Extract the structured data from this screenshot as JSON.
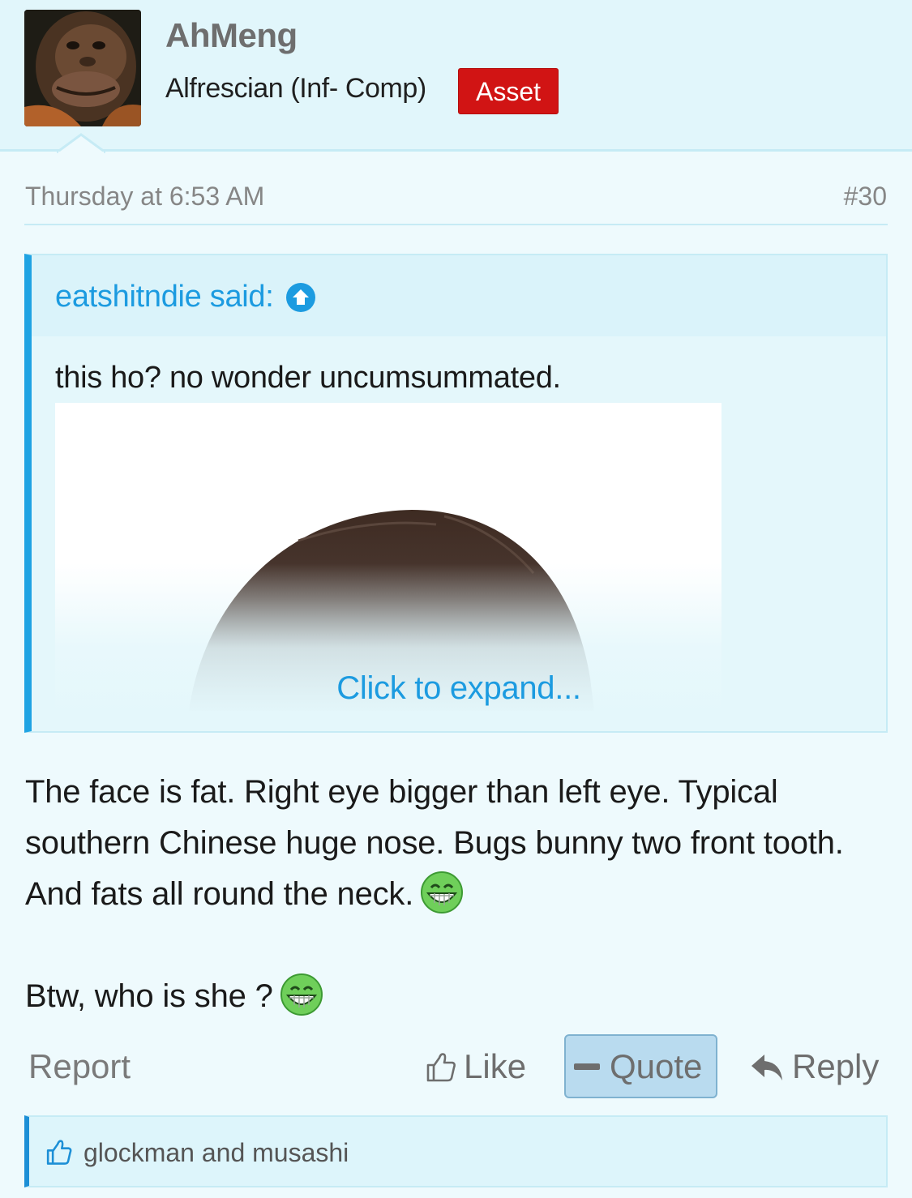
{
  "user": {
    "name": "AhMeng",
    "title": "Alfrescian (Inf- Comp)",
    "badge": "Asset"
  },
  "post": {
    "date": "Thursday at 6:53 AM",
    "number": "#30",
    "quote": {
      "author": "eatshitndie said:",
      "text": "this ho? no wonder uncumsummated.",
      "expand_label": "Click to expand..."
    },
    "body": [
      "The face is fat. Right eye bigger than left eye. Typical southern Chinese huge nose. Bugs bunny two front tooth. And fats all round the neck.",
      "Btw, who is she ?"
    ]
  },
  "actions": {
    "report": "Report",
    "like": "Like",
    "quote": "Quote",
    "reply": "Reply"
  },
  "likes": {
    "text": "glockman and musashi"
  },
  "colors": {
    "accent": "#1c9be0",
    "badge": "#d11414",
    "background": "#eefafd"
  },
  "icons": [
    "arrow-up-circle-icon",
    "grin-smiley-icon",
    "thumbs-up-icon",
    "minus-icon",
    "reply-arrow-icon"
  ]
}
